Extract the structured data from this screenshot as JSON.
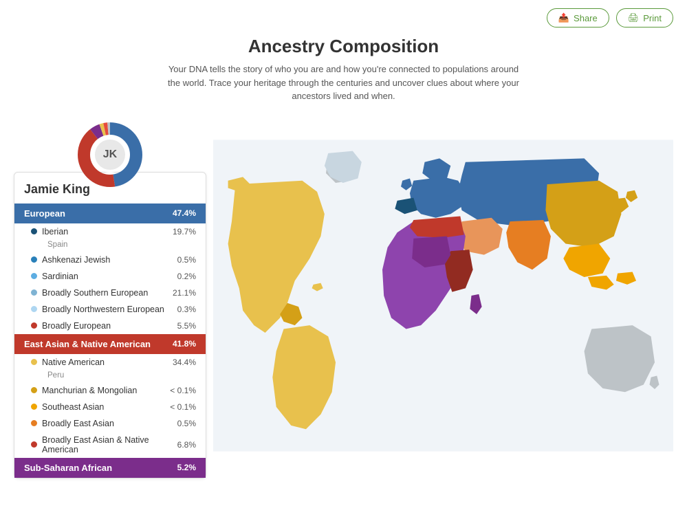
{
  "header": {
    "title": "Ancestry Composition",
    "subtitle": "Your DNA tells the story of who you are and how you're connected to populations around the world. Trace your heritage through the centuries and uncover clues about where your ancestors lived and when.",
    "share_label": "Share",
    "print_label": "Print"
  },
  "person": {
    "initials": "JK",
    "name": "Jamie King"
  },
  "categories": [
    {
      "id": "european",
      "label": "European",
      "pct": "47.4%",
      "bg": "#3a6ea8",
      "items": [
        {
          "label": "Iberian",
          "pct": "19.7%",
          "color": "#1a5276",
          "sub": "Spain"
        },
        {
          "label": "Ashkenazi Jewish",
          "pct": "0.5%",
          "color": "#2980b9"
        },
        {
          "label": "Sardinian",
          "pct": "0.2%",
          "color": "#5dade2"
        },
        {
          "label": "Broadly Southern European",
          "pct": "21.1%",
          "color": "#7fb3d3"
        },
        {
          "label": "Broadly Northwestern European",
          "pct": "0.3%",
          "color": "#aed6f1"
        },
        {
          "label": "Broadly European",
          "pct": "5.5%",
          "color": "#c0392b"
        }
      ]
    },
    {
      "id": "east-asian",
      "label": "East Asian & Native American",
      "pct": "41.8%",
      "bg": "#c0392b",
      "items": [
        {
          "label": "Native American",
          "pct": "34.4%",
          "color": "#e8c14d",
          "sub": "Peru"
        },
        {
          "label": "Manchurian & Mongolian",
          "pct": "< 0.1%",
          "color": "#d4a017"
        },
        {
          "label": "Southeast Asian",
          "pct": "< 0.1%",
          "color": "#f0a500"
        },
        {
          "label": "Broadly East Asian",
          "pct": "0.5%",
          "color": "#e67e22"
        },
        {
          "label": "Broadly East Asian & Native American",
          "pct": "6.8%",
          "color": "#c0392b"
        }
      ]
    },
    {
      "id": "sub-saharan",
      "label": "Sub-Saharan African",
      "pct": "5.2%",
      "bg": "#7b2d8b"
    }
  ],
  "donut": {
    "segments": [
      {
        "color": "#3a6ea8",
        "pct": 47.4
      },
      {
        "color": "#c0392b",
        "pct": 41.8
      },
      {
        "color": "#7b2d8b",
        "pct": 5.2
      },
      {
        "color": "#e8c14d",
        "pct": 2.0
      },
      {
        "color": "#e74c3c",
        "pct": 2.0
      },
      {
        "color": "#bdc3c7",
        "pct": 1.6
      }
    ]
  },
  "dot_colors": {
    "iberian": "#1a5276",
    "ashkenazi": "#2980b9",
    "sardinian": "#5dade2",
    "broadly_southern": "#7fb3d3",
    "broadly_northwestern": "#aed6f1",
    "broadly_european": "#c0392b",
    "native_american": "#e8c14d",
    "manchurian": "#d4a017",
    "southeast_asian": "#f0a500",
    "broadly_east_asian": "#e67e22",
    "broadly_east_asian_native": "#c0392b"
  }
}
